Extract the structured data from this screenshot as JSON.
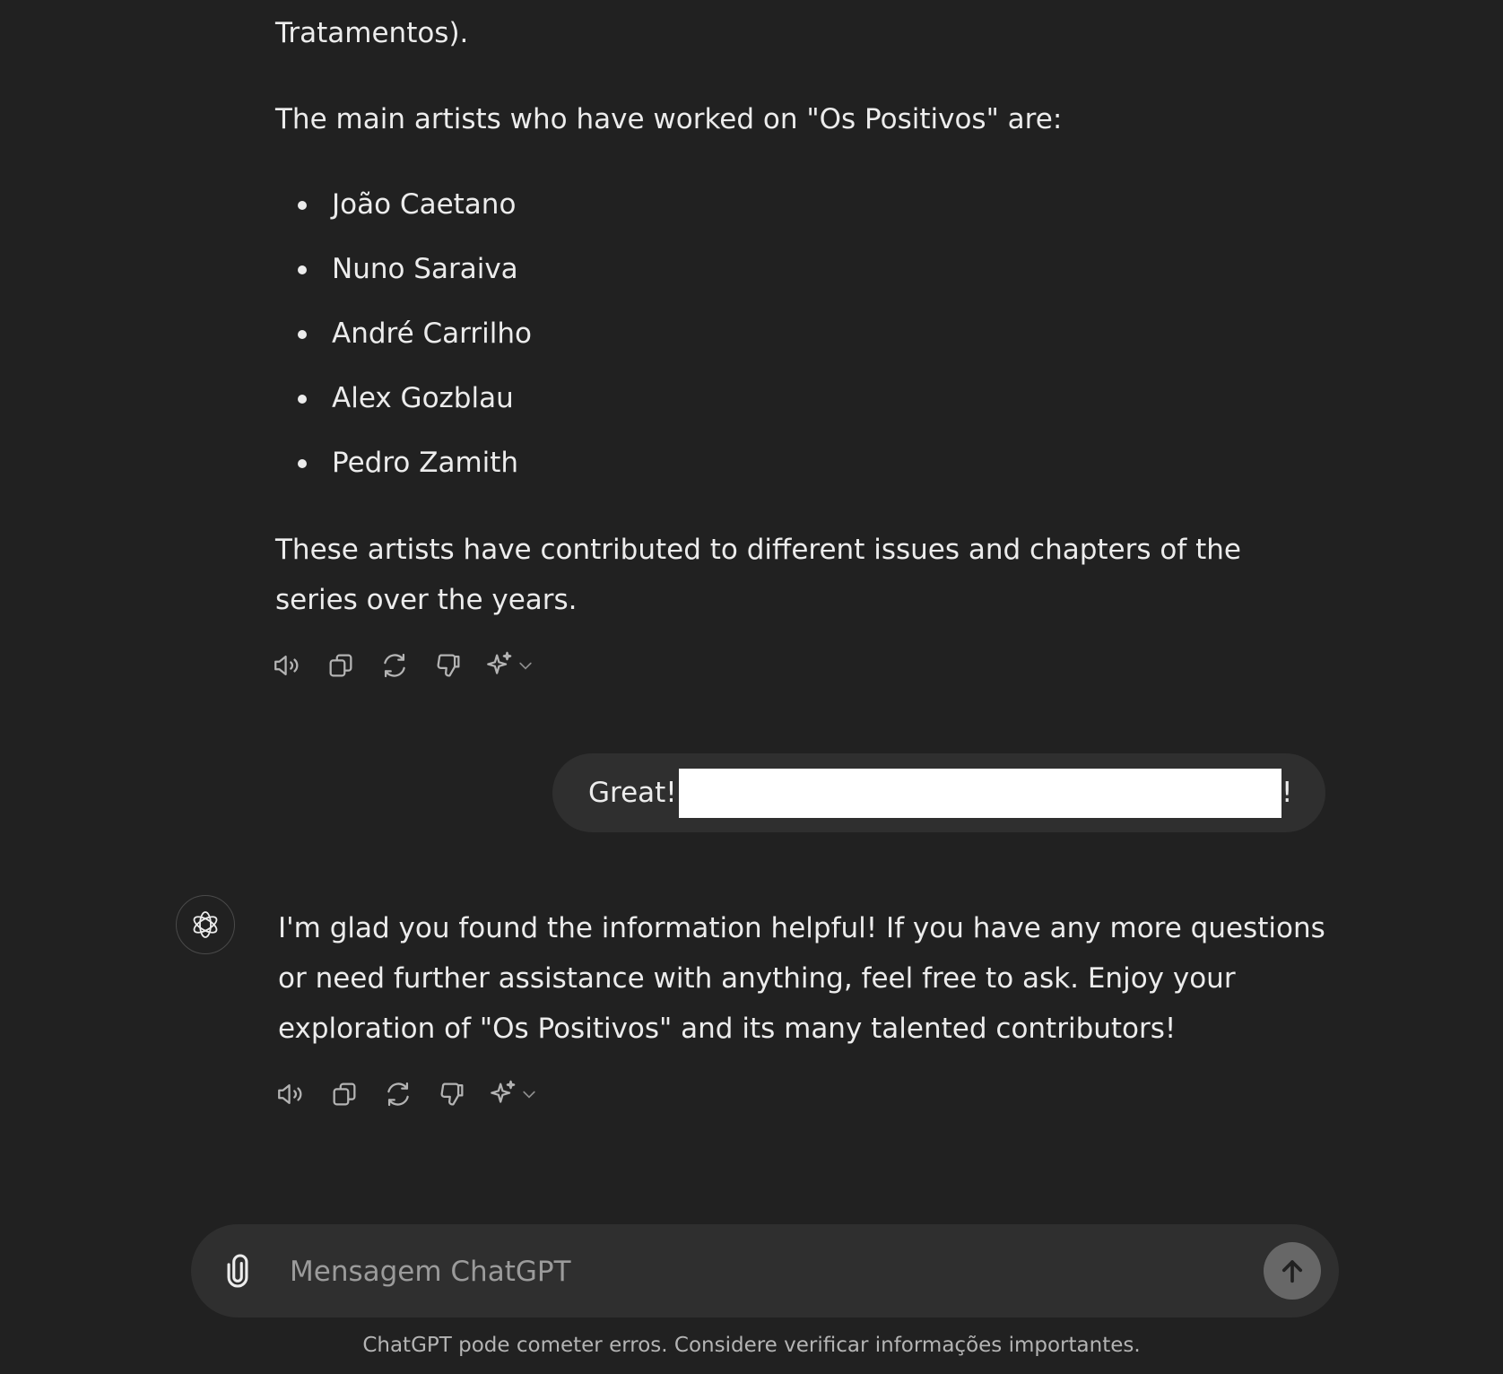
{
  "conversation": {
    "assistant_prev": {
      "tail_line": "Tratamentos).",
      "intro": "The main artists who have worked on \"Os Positivos\" are:",
      "artists": [
        "João Caetano",
        "Nuno Saraiva",
        "André Carrilho",
        "Alex Gozblau",
        "Pedro Zamith"
      ],
      "closing": "These artists have contributed to different issues and chapters of the series over the years."
    },
    "user_message": {
      "start": "Great!",
      "end": "!"
    },
    "assistant_last": {
      "text": "I'm glad you found the information helpful! If you have any more questions or need further assistance with anything, feel free to ask. Enjoy your exploration of \"Os Positivos\" and its many talented contributors!"
    },
    "action_icons": [
      "speaker-icon",
      "copy-icon",
      "regenerate-icon",
      "thumbs-down-icon",
      "sparkle-icon",
      "chevron-down-icon"
    ]
  },
  "composer": {
    "placeholder": "Mensagem ChatGPT",
    "attach_icon": "paperclip-icon",
    "send_icon": "arrow-up-icon"
  },
  "footer": {
    "disclaimer": "ChatGPT pode cometer erros. Considere verificar informações importantes."
  },
  "colors": {
    "background": "#212121",
    "bubble": "#2f2f2f",
    "text": "#ececec",
    "muted": "#b4b4b4",
    "send_button": "#676767"
  }
}
